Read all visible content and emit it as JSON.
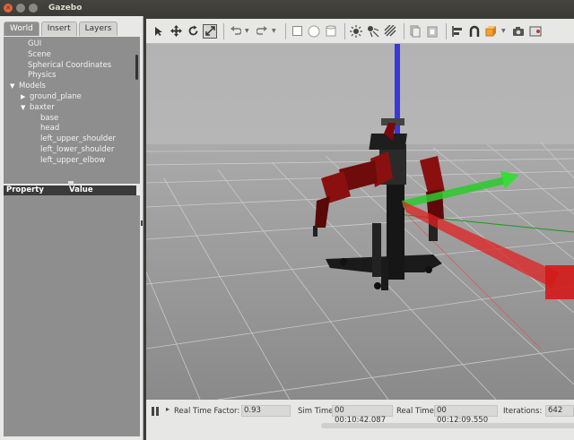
{
  "window": {
    "title": "Gazebo"
  },
  "tabs": [
    {
      "label": "World",
      "active": true
    },
    {
      "label": "Insert",
      "active": false
    },
    {
      "label": "Layers",
      "active": false
    }
  ],
  "tree": {
    "items": [
      {
        "label": "GUI",
        "level": 0
      },
      {
        "label": "Scene",
        "level": 0
      },
      {
        "label": "Spherical Coordinates",
        "level": 0
      },
      {
        "label": "Physics",
        "level": 0
      },
      {
        "label": "Models",
        "level": 0,
        "expanded": true
      },
      {
        "label": "ground_plane",
        "level": 1,
        "expanded": false
      },
      {
        "label": "baxter",
        "level": 1,
        "expanded": true
      },
      {
        "label": "base",
        "level": 2
      },
      {
        "label": "head",
        "level": 2
      },
      {
        "label": "left_upper_shoulder",
        "level": 2
      },
      {
        "label": "left_lower_shoulder",
        "level": 2
      },
      {
        "label": "left_upper_elbow",
        "level": 2
      }
    ]
  },
  "properties": {
    "col_property": "Property",
    "col_value": "Value"
  },
  "toolbar": {
    "icons": [
      "select-arrow-icon",
      "translate-icon",
      "rotate-icon",
      "scale-icon",
      "undo-icon",
      "redo-icon",
      "box-icon",
      "sphere-icon",
      "cylinder-icon",
      "point-light-icon",
      "spot-light-icon",
      "directional-light-icon",
      "copy-icon",
      "paste-icon",
      "align-icon",
      "snap-icon",
      "change-view-icon",
      "screenshot-icon",
      "log-icon"
    ]
  },
  "status": {
    "rtf_label": "Real Time Factor:",
    "rtf_value": "0.93",
    "sim_label": "Sim Time:",
    "sim_value": "00 00:10:42.087",
    "real_label": "Real Time:",
    "real_value": "00 00:12:09.550",
    "iter_label": "Iterations:",
    "iter_value": "642"
  },
  "colors": {
    "x_axis": "#e02020",
    "y_axis": "#20c020",
    "z_axis": "#2020e0",
    "robot": "#8b1010"
  }
}
